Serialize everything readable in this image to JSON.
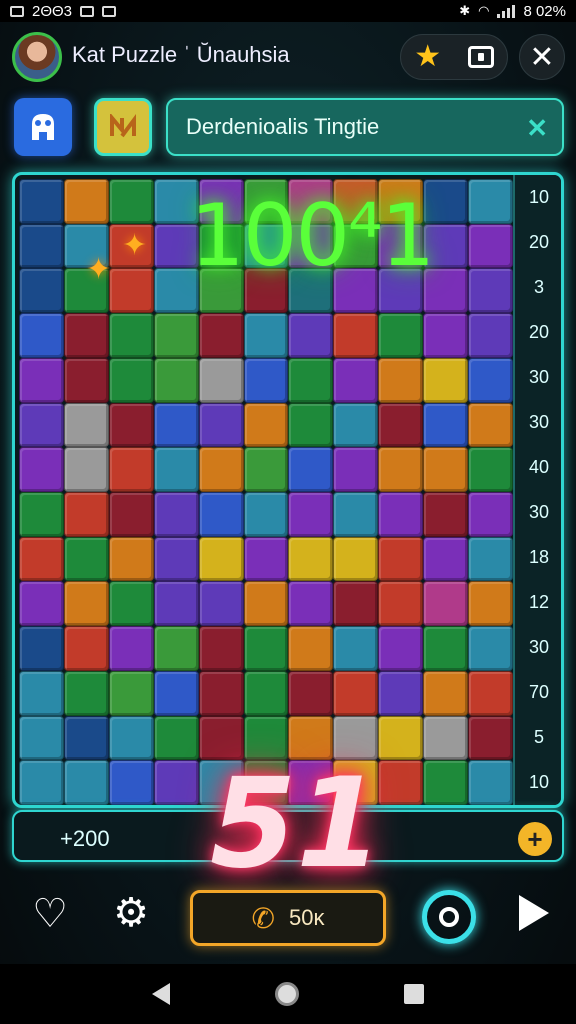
{
  "status_bar": {
    "left_time": "2ΘΘ3",
    "battery": "8 02%"
  },
  "header": {
    "title": "Kat Puzzle ˈ Ŭnauhsia"
  },
  "toolbar": {
    "search_value": "Derdenioalis Tingtie"
  },
  "game": {
    "big_score": "100⁴1",
    "side_numbers": [
      "10",
      "20",
      "3",
      "20",
      "30",
      "30",
      "40",
      "30",
      "18",
      "12",
      "30",
      "70",
      "5",
      "10"
    ],
    "bonus_text": "51",
    "palette": [
      "#c23b2a",
      "#1e8a3a",
      "#2f59c8",
      "#7a2fb8",
      "#d07a1a",
      "#d4b21c",
      "#1e6f7a",
      "#8a1e2e",
      "#3a9a3a",
      "#b03a8a",
      "#5e3ab8",
      "#c85a2a",
      "#2a8aa8",
      "#6a8a2a",
      "#9a9a9a",
      "#1a4a8a"
    ],
    "grid": [
      [
        15,
        4,
        1,
        12,
        3,
        8,
        9,
        11,
        4,
        15,
        12
      ],
      [
        15,
        12,
        0,
        10,
        1,
        12,
        3,
        8,
        3,
        10,
        3
      ],
      [
        15,
        1,
        0,
        12,
        8,
        7,
        6,
        3,
        10,
        3,
        10
      ],
      [
        2,
        7,
        1,
        8,
        7,
        12,
        10,
        0,
        1,
        3,
        10
      ],
      [
        3,
        7,
        1,
        8,
        14,
        2,
        1,
        3,
        4,
        5,
        2
      ],
      [
        10,
        14,
        7,
        2,
        10,
        4,
        1,
        12,
        7,
        2,
        4
      ],
      [
        3,
        14,
        0,
        12,
        4,
        8,
        2,
        3,
        4,
        4,
        1
      ],
      [
        1,
        0,
        7,
        10,
        2,
        12,
        3,
        12,
        3,
        7,
        3
      ],
      [
        0,
        1,
        4,
        10,
        5,
        3,
        5,
        5,
        0,
        3,
        12
      ],
      [
        3,
        4,
        1,
        10,
        10,
        4,
        3,
        7,
        0,
        9,
        4
      ],
      [
        15,
        0,
        3,
        8,
        7,
        1,
        4,
        12,
        3,
        1,
        12
      ],
      [
        12,
        1,
        8,
        2,
        7,
        1,
        7,
        0,
        10,
        4,
        0
      ],
      [
        12,
        15,
        12,
        1,
        7,
        1,
        4,
        14,
        5,
        14,
        7
      ],
      [
        12,
        12,
        2,
        10,
        12,
        1,
        3,
        5,
        0,
        1,
        12
      ]
    ]
  },
  "score_bar": {
    "value": "+200",
    "plus_label": "+"
  },
  "controls": {
    "call_label": "50ĸ"
  }
}
